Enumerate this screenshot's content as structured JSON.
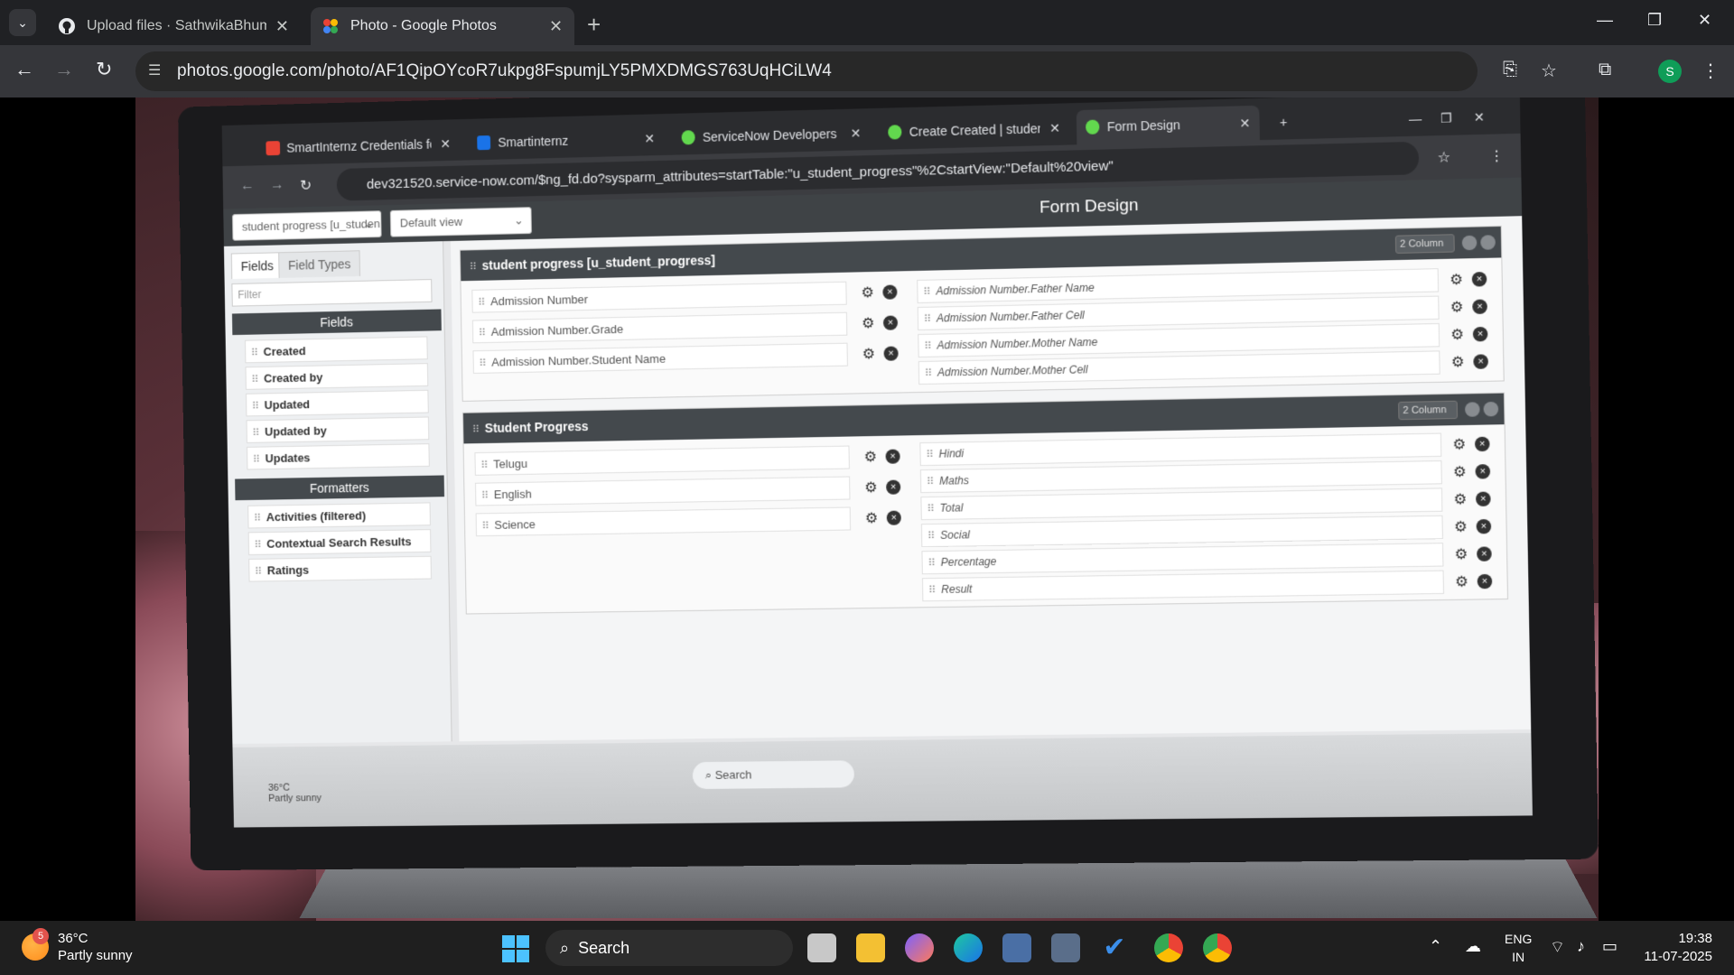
{
  "browser": {
    "tabs": [
      {
        "title": "Upload files · SathwikaBhuma/-",
        "active": false
      },
      {
        "title": "Photo - Google Photos",
        "active": true
      }
    ],
    "url": "photos.google.com/photo/AF1QipOYcoR7ukpg8FspumjLY5PMXDMGS763UqHCiLW4",
    "profile_initial": "S"
  },
  "photo": {
    "inner_browser": {
      "tabs": [
        {
          "title": "SmartInternz Credentials for Sh"
        },
        {
          "title": "Smartinternz"
        },
        {
          "title": "ServiceNow Developers"
        },
        {
          "title": "Create Created | student progre"
        },
        {
          "title": "Form Design"
        }
      ],
      "url": "dev321520.service-now.com/$ng_fd.do?sysparm_attributes=startTable:\"u_student_progress\"%2CstartView:\"Default%20view\""
    },
    "form_designer": {
      "table_select": "student progress [u_studen",
      "view_select": "Default view",
      "title": "Form Design",
      "left_tabs": [
        "Fields",
        "Field Types"
      ],
      "filter_placeholder": "Filter",
      "fields_header": "Fields",
      "fields": [
        "Created",
        "Created by",
        "Updated",
        "Updated by",
        "Updates"
      ],
      "formatters_header": "Formatters",
      "formatters": [
        "Activities (filtered)",
        "Contextual Search Results",
        "Ratings"
      ],
      "sections": [
        {
          "title": "student progress [u_student_progress]",
          "columns": "2 Column",
          "left": [
            "Admission Number",
            "Admission Number.Grade",
            "Admission Number.Student Name"
          ],
          "right": [
            "Admission Number.Father Name",
            "Admission Number.Father Cell",
            "Admission Number.Mother Name",
            "Admission Number.Mother Cell"
          ]
        },
        {
          "title": "Student Progress",
          "columns": "2 Column",
          "left": [
            "Telugu",
            "English",
            "Science"
          ],
          "right": [
            "Hindi",
            "Maths",
            "Total",
            "Social",
            "Percentage",
            "Result"
          ]
        }
      ]
    },
    "inner_taskbar": {
      "search": "Search",
      "weather_temp": "36°C",
      "weather_desc": "Partly sunny"
    }
  },
  "taskbar": {
    "weather_temp": "36°C",
    "weather_desc": "Partly sunny",
    "weather_badge": "5",
    "search": "Search",
    "lang_1": "ENG",
    "lang_2": "IN",
    "time": "19:38",
    "date": "11-07-2025"
  }
}
